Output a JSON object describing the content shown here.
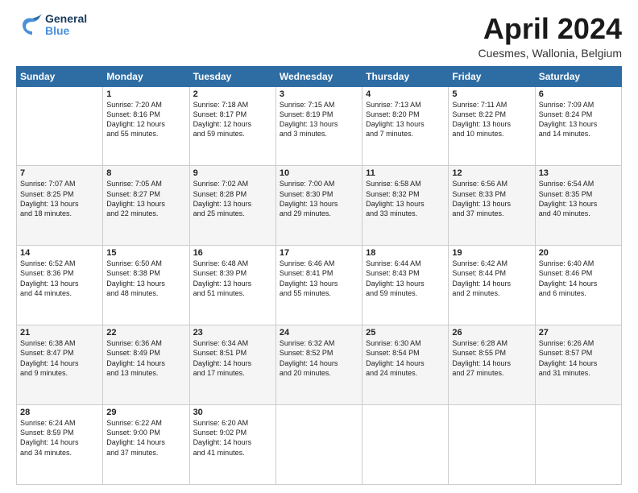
{
  "header": {
    "logo_general": "General",
    "logo_blue": "Blue",
    "month_title": "April 2024",
    "location": "Cuesmes, Wallonia, Belgium"
  },
  "days_of_week": [
    "Sunday",
    "Monday",
    "Tuesday",
    "Wednesday",
    "Thursday",
    "Friday",
    "Saturday"
  ],
  "weeks": [
    [
      {
        "day": "",
        "content": ""
      },
      {
        "day": "1",
        "content": "Sunrise: 7:20 AM\nSunset: 8:16 PM\nDaylight: 12 hours\nand 55 minutes."
      },
      {
        "day": "2",
        "content": "Sunrise: 7:18 AM\nSunset: 8:17 PM\nDaylight: 12 hours\nand 59 minutes."
      },
      {
        "day": "3",
        "content": "Sunrise: 7:15 AM\nSunset: 8:19 PM\nDaylight: 13 hours\nand 3 minutes."
      },
      {
        "day": "4",
        "content": "Sunrise: 7:13 AM\nSunset: 8:20 PM\nDaylight: 13 hours\nand 7 minutes."
      },
      {
        "day": "5",
        "content": "Sunrise: 7:11 AM\nSunset: 8:22 PM\nDaylight: 13 hours\nand 10 minutes."
      },
      {
        "day": "6",
        "content": "Sunrise: 7:09 AM\nSunset: 8:24 PM\nDaylight: 13 hours\nand 14 minutes."
      }
    ],
    [
      {
        "day": "7",
        "content": "Sunrise: 7:07 AM\nSunset: 8:25 PM\nDaylight: 13 hours\nand 18 minutes."
      },
      {
        "day": "8",
        "content": "Sunrise: 7:05 AM\nSunset: 8:27 PM\nDaylight: 13 hours\nand 22 minutes."
      },
      {
        "day": "9",
        "content": "Sunrise: 7:02 AM\nSunset: 8:28 PM\nDaylight: 13 hours\nand 25 minutes."
      },
      {
        "day": "10",
        "content": "Sunrise: 7:00 AM\nSunset: 8:30 PM\nDaylight: 13 hours\nand 29 minutes."
      },
      {
        "day": "11",
        "content": "Sunrise: 6:58 AM\nSunset: 8:32 PM\nDaylight: 13 hours\nand 33 minutes."
      },
      {
        "day": "12",
        "content": "Sunrise: 6:56 AM\nSunset: 8:33 PM\nDaylight: 13 hours\nand 37 minutes."
      },
      {
        "day": "13",
        "content": "Sunrise: 6:54 AM\nSunset: 8:35 PM\nDaylight: 13 hours\nand 40 minutes."
      }
    ],
    [
      {
        "day": "14",
        "content": "Sunrise: 6:52 AM\nSunset: 8:36 PM\nDaylight: 13 hours\nand 44 minutes."
      },
      {
        "day": "15",
        "content": "Sunrise: 6:50 AM\nSunset: 8:38 PM\nDaylight: 13 hours\nand 48 minutes."
      },
      {
        "day": "16",
        "content": "Sunrise: 6:48 AM\nSunset: 8:39 PM\nDaylight: 13 hours\nand 51 minutes."
      },
      {
        "day": "17",
        "content": "Sunrise: 6:46 AM\nSunset: 8:41 PM\nDaylight: 13 hours\nand 55 minutes."
      },
      {
        "day": "18",
        "content": "Sunrise: 6:44 AM\nSunset: 8:43 PM\nDaylight: 13 hours\nand 59 minutes."
      },
      {
        "day": "19",
        "content": "Sunrise: 6:42 AM\nSunset: 8:44 PM\nDaylight: 14 hours\nand 2 minutes."
      },
      {
        "day": "20",
        "content": "Sunrise: 6:40 AM\nSunset: 8:46 PM\nDaylight: 14 hours\nand 6 minutes."
      }
    ],
    [
      {
        "day": "21",
        "content": "Sunrise: 6:38 AM\nSunset: 8:47 PM\nDaylight: 14 hours\nand 9 minutes."
      },
      {
        "day": "22",
        "content": "Sunrise: 6:36 AM\nSunset: 8:49 PM\nDaylight: 14 hours\nand 13 minutes."
      },
      {
        "day": "23",
        "content": "Sunrise: 6:34 AM\nSunset: 8:51 PM\nDaylight: 14 hours\nand 17 minutes."
      },
      {
        "day": "24",
        "content": "Sunrise: 6:32 AM\nSunset: 8:52 PM\nDaylight: 14 hours\nand 20 minutes."
      },
      {
        "day": "25",
        "content": "Sunrise: 6:30 AM\nSunset: 8:54 PM\nDaylight: 14 hours\nand 24 minutes."
      },
      {
        "day": "26",
        "content": "Sunrise: 6:28 AM\nSunset: 8:55 PM\nDaylight: 14 hours\nand 27 minutes."
      },
      {
        "day": "27",
        "content": "Sunrise: 6:26 AM\nSunset: 8:57 PM\nDaylight: 14 hours\nand 31 minutes."
      }
    ],
    [
      {
        "day": "28",
        "content": "Sunrise: 6:24 AM\nSunset: 8:59 PM\nDaylight: 14 hours\nand 34 minutes."
      },
      {
        "day": "29",
        "content": "Sunrise: 6:22 AM\nSunset: 9:00 PM\nDaylight: 14 hours\nand 37 minutes."
      },
      {
        "day": "30",
        "content": "Sunrise: 6:20 AM\nSunset: 9:02 PM\nDaylight: 14 hours\nand 41 minutes."
      },
      {
        "day": "",
        "content": ""
      },
      {
        "day": "",
        "content": ""
      },
      {
        "day": "",
        "content": ""
      },
      {
        "day": "",
        "content": ""
      }
    ]
  ]
}
